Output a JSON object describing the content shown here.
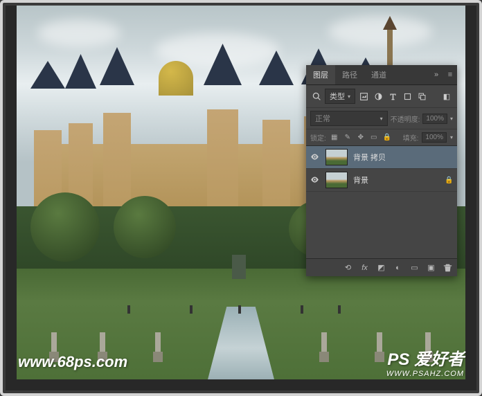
{
  "watermarks": {
    "left": "www.68ps.com",
    "right_main": "PS 爱好者",
    "right_sub": "WWW.PSAHZ.COM"
  },
  "panel": {
    "tabs": {
      "layers": "图层",
      "paths": "路径",
      "channels": "通道"
    },
    "filter_label": "类型",
    "blend_mode": "正常",
    "opacity_label": "不透明度:",
    "opacity_value": "100%",
    "lock_label": "锁定:",
    "fill_label": "填充:",
    "fill_value": "100%",
    "layers": [
      {
        "name": "背景 拷贝",
        "visible": true,
        "locked": false
      },
      {
        "name": "背景",
        "visible": true,
        "locked": true
      }
    ]
  },
  "icons": {
    "search": "search-icon",
    "image_filter": "image-filter-icon",
    "adjust_filter": "adjustment-filter-icon",
    "text_filter": "text-filter-icon",
    "shape_filter": "shape-filter-icon",
    "smart_filter": "smart-filter-icon"
  }
}
